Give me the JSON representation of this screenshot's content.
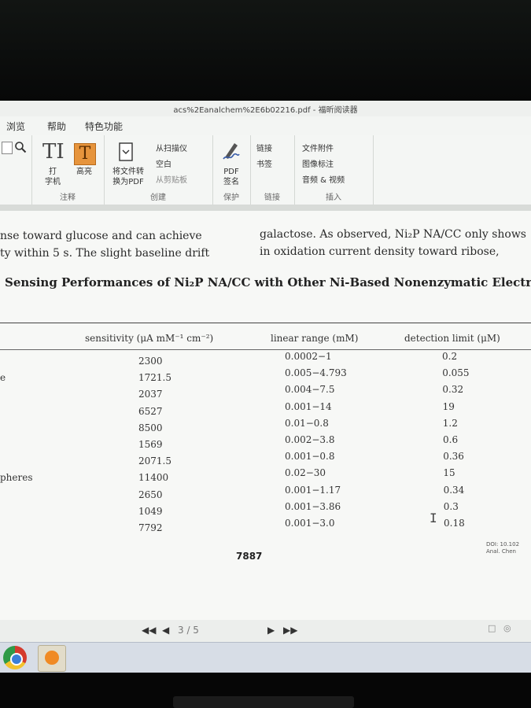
{
  "window": {
    "title": "acs%2Eanalchem%2E6b02216.pdf - 福昕阅读器"
  },
  "menu": [
    "浏览",
    "帮助",
    "特色功能"
  ],
  "ribbon": {
    "typewriter_label": "打\n字机",
    "highlight_label": "高亮",
    "group_comment": "注释",
    "convert_label": "将文件转\n换为PDF",
    "from_scanner": "从扫描仪",
    "blank": "空白",
    "from_clipboard": "从剪贴板",
    "group_create": "创建",
    "pdf_sign_label": "PDF\n签名",
    "group_protect": "保护",
    "link": "链接",
    "bookmark": "书签",
    "group_links": "链接",
    "file_attachment": "文件附件",
    "image_annotation": "图像标注",
    "audio_video": "音频 & 视频",
    "group_insert": "插入"
  },
  "document": {
    "left_line1": "nse toward glucose and can achieve",
    "left_line2": "ty within 5 s. The slight baseline drift",
    "right_line1": "galactose. As observed, Ni₂P NA/CC only shows",
    "right_line2": "in oxidation current density toward ribose,",
    "caption": "Sensing Performances of Ni₂P NA/CC with Other Ni-Based Nonenzymatic Electroche",
    "table": {
      "headers": [
        "sensitivity (μA mM⁻¹ cm⁻²)",
        "linear range (mM)",
        "detection limit (μM)"
      ],
      "row_labels": [
        "",
        "e",
        "",
        "",
        "",
        "",
        "",
        "pheres",
        "",
        "",
        ""
      ],
      "sensitivity": [
        "2300",
        "1721.5",
        "2037",
        "6527",
        "8500",
        "1569",
        "2071.5",
        "11400",
        "2650",
        "1049",
        "7792"
      ],
      "linear_range": [
        "0.0002−1",
        "0.005−4.793",
        "0.004−7.5",
        "0.001−14",
        "0.01−0.8",
        "0.002−3.8",
        "0.001−0.8",
        "0.02−30",
        "0.001−1.17",
        "0.001−3.86",
        "0.001−3.0"
      ],
      "detection_limit": [
        "0.2",
        "0.055",
        "0.32",
        "19",
        "1.2",
        "0.6",
        "0.36",
        "15",
        "0.34",
        "0.3",
        "0.18"
      ]
    },
    "page_number": "7887",
    "doi_line1": "DOI: 10.102",
    "doi_line2": "Anal. Chen"
  },
  "navigation": {
    "page_indicator": "3 / 5"
  },
  "icons": {
    "zoom": "magnifier-icon",
    "typewriter": "typewriter-icon",
    "highlight": "highlight-icon",
    "convert": "convert-pdf-icon",
    "sign": "pdf-sign-icon",
    "chrome": "chrome-icon",
    "foxit": "foxit-reader-icon"
  },
  "colors": {
    "highlight_accent": "#e6943c",
    "taskbar": "#d7dde6"
  }
}
